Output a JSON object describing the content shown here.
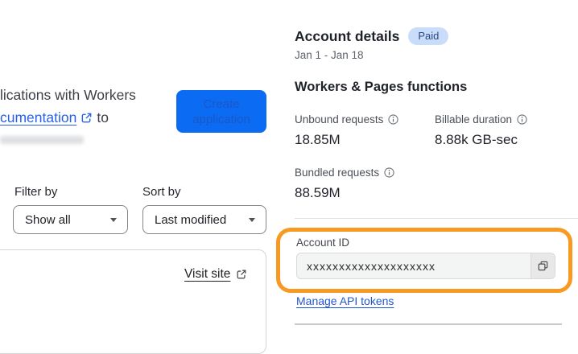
{
  "left_panel": {
    "intro": {
      "line1": "lications with Workers",
      "link_text": "cumentation",
      "after_link": "to"
    },
    "create_button_label": "Create application",
    "filter": {
      "label": "Filter by",
      "value": "Show all"
    },
    "sort": {
      "label": "Sort by",
      "value": "Last modified"
    },
    "project_card": {
      "visit_site_label": "Visit site"
    }
  },
  "account_panel": {
    "title": "Account details",
    "plan_badge": "Paid",
    "date_range": "Jan 1 - Jan 18",
    "functions_section": {
      "title": "Workers & Pages functions",
      "stats": [
        {
          "label": "Unbound requests",
          "value": "18.85M"
        },
        {
          "label": "Billable duration",
          "value": "8.88k GB-sec"
        },
        {
          "label": "Bundled requests",
          "value": "88.59M"
        }
      ]
    },
    "account_id": {
      "label": "Account ID",
      "value": "xxxxxxxxxxxxxxxxxxxx"
    },
    "manage_api_tokens_label": "Manage API tokens"
  },
  "icons": {
    "external_link": "external-link",
    "info": "info-circle",
    "copy": "copy",
    "dropdown_caret": "caret-down"
  },
  "colors": {
    "button_blue": "#0b6cf3",
    "button_text_blue": "#1b57c8",
    "link_blue": "#2862e9",
    "manage_link_blue": "#2157cd",
    "badge_bg": "#c9ddfb",
    "badge_text": "#274a7f",
    "highlight_orange": "#f89922",
    "input_bg": "#f3f4f4"
  }
}
